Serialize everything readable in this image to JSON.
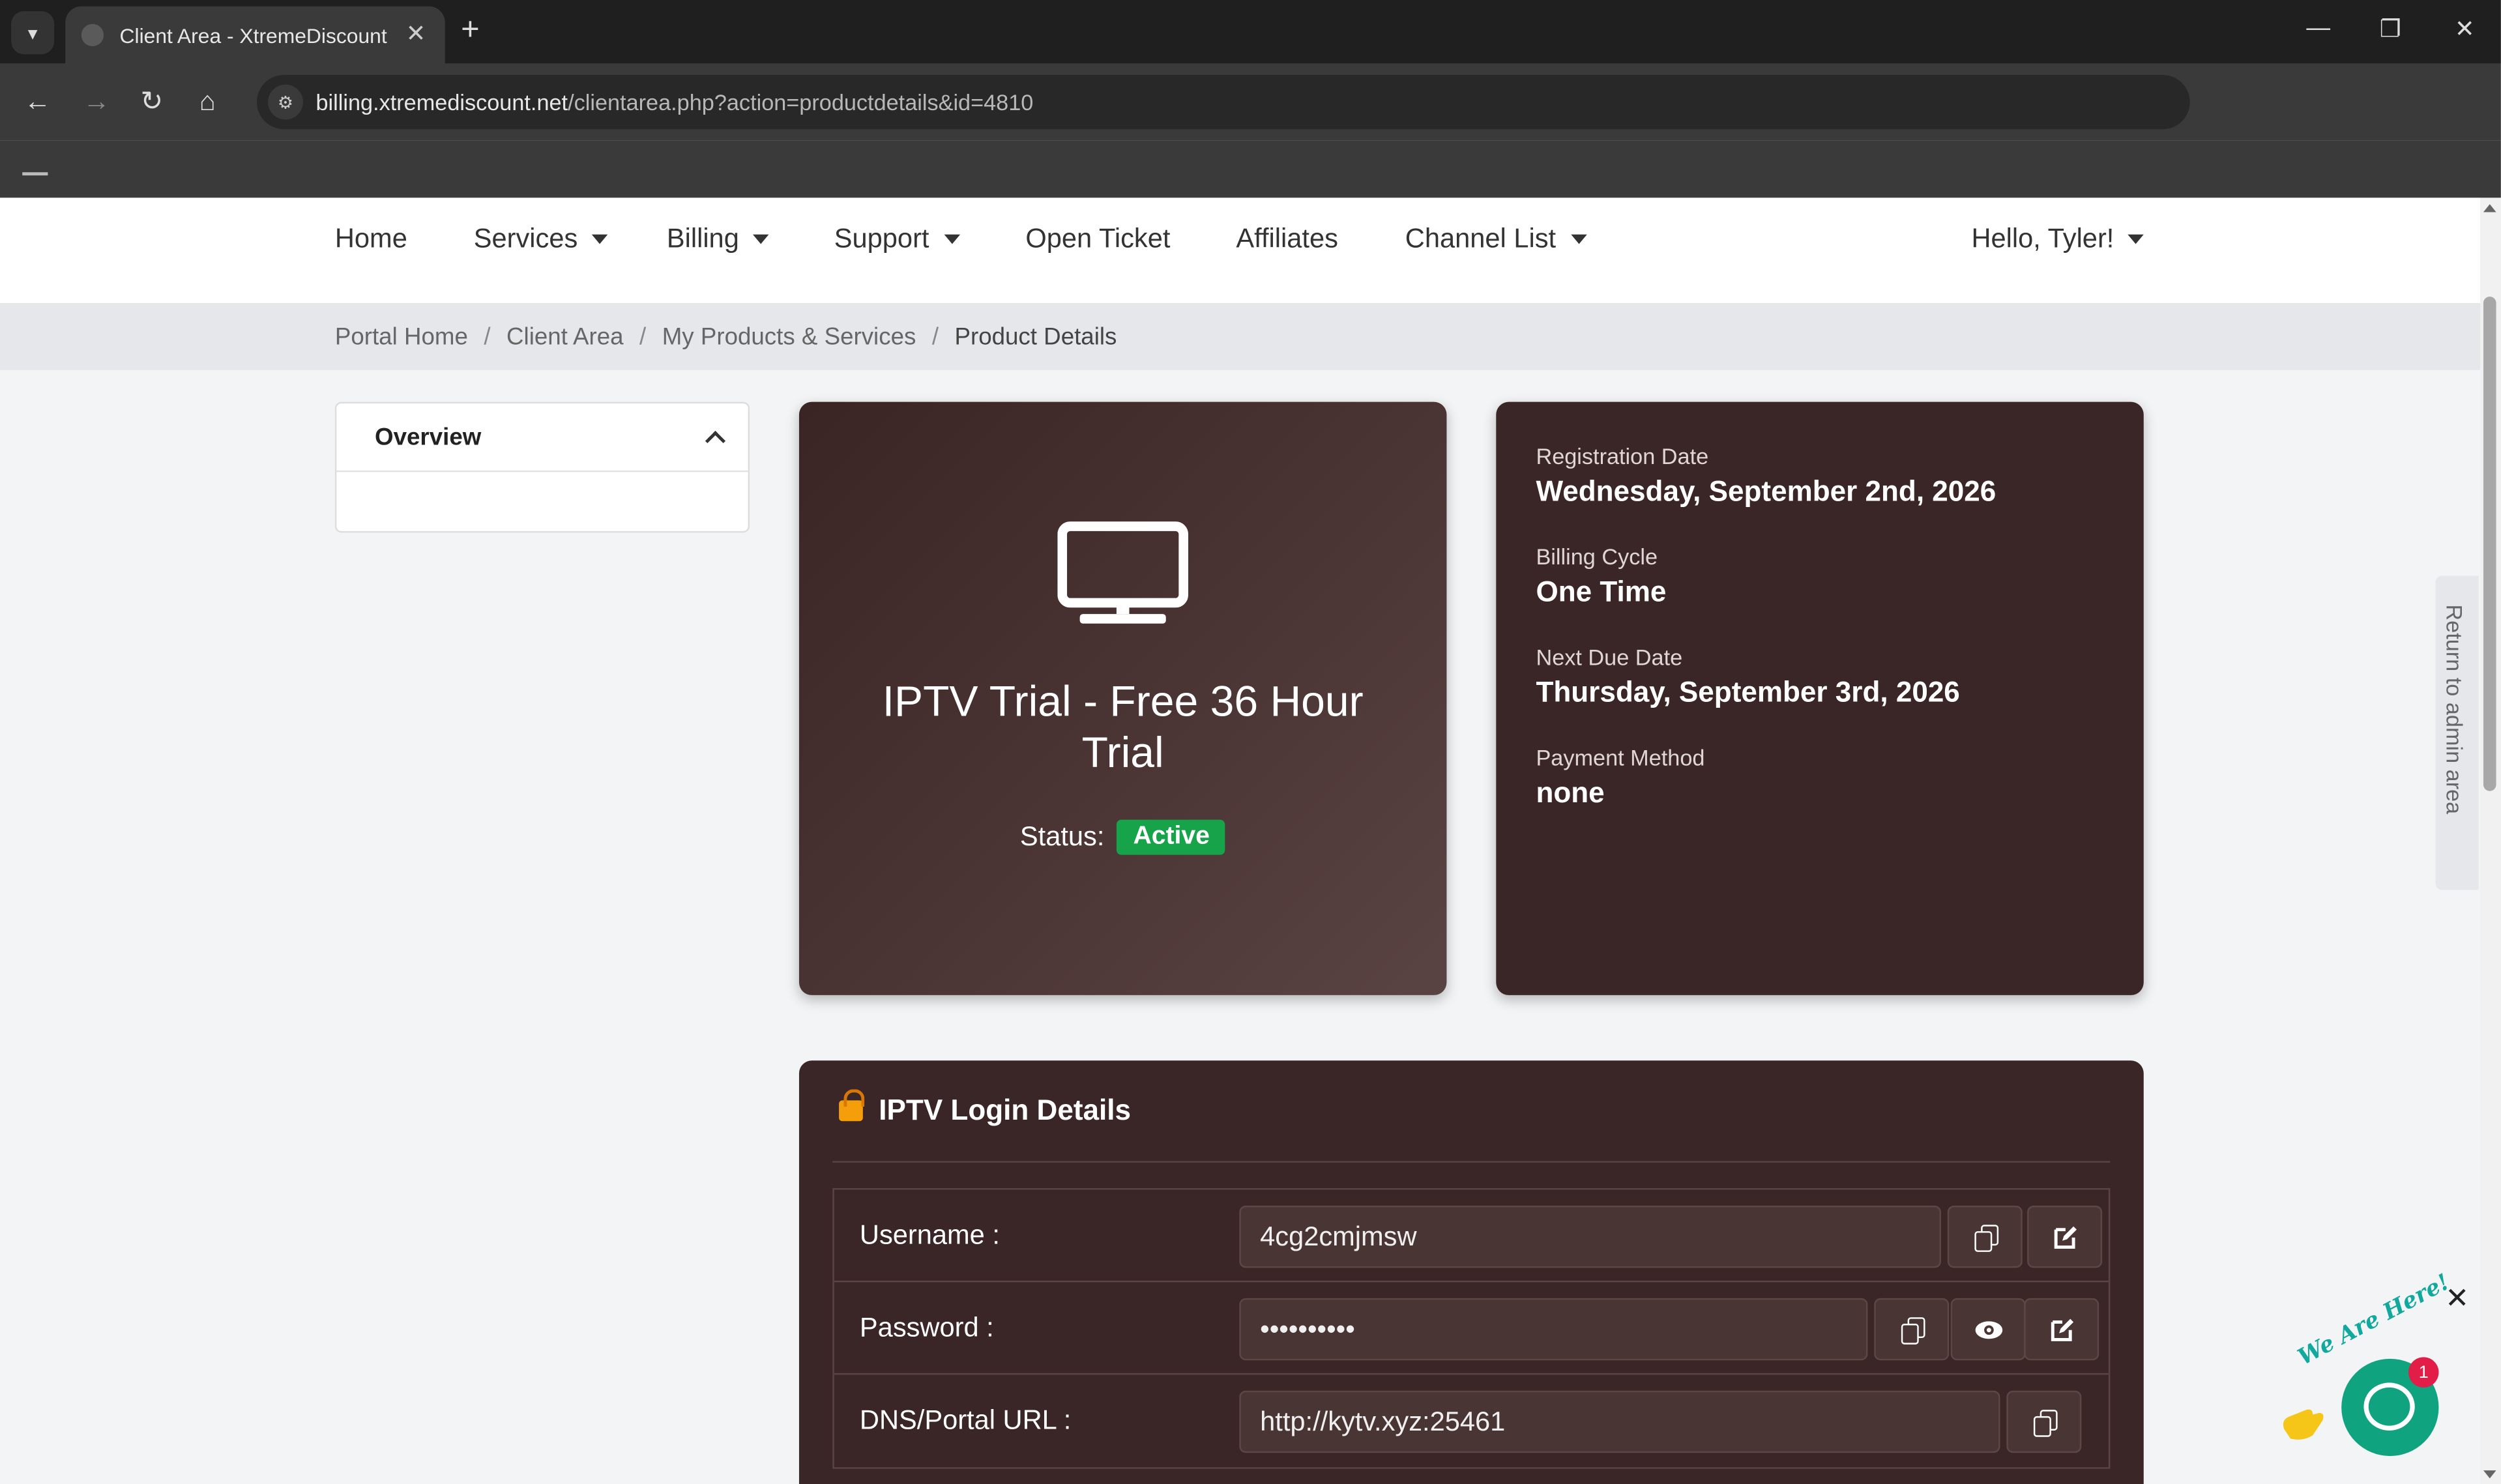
{
  "browser": {
    "tab_title": "Client Area - XtremeDiscount",
    "url_domain": "billing.xtremediscount.net",
    "url_path": "/clientarea.php?action=productdetails&id=4810"
  },
  "nav": {
    "home": "Home",
    "services": "Services",
    "billing": "Billing",
    "support": "Support",
    "open_ticket": "Open Ticket",
    "affiliates": "Affiliates",
    "channel_list": "Channel List",
    "user": "Hello, Tyler!"
  },
  "breadcrumb": {
    "portal_home": "Portal Home",
    "client_area": "Client Area",
    "products": "My Products & Services",
    "current": "Product Details",
    "separator": "/"
  },
  "sidebar": {
    "overview": "Overview"
  },
  "product": {
    "icon": "monitor-icon",
    "name": "IPTV Trial - Free 36 Hour Trial",
    "status_label": "Status:",
    "status_value": "Active",
    "status_color": "#16a34a"
  },
  "info": {
    "registration_label": "Registration Date",
    "registration_value": "Wednesday, September 2nd, 2026",
    "billing_cycle_label": "Billing Cycle",
    "billing_cycle_value": "One Time",
    "next_due_label": "Next Due Date",
    "next_due_value": "Thursday, September 3rd, 2026",
    "payment_method_label": "Payment Method",
    "payment_method_value": "none"
  },
  "login": {
    "title": "IPTV Login Details",
    "username_label": "Username :",
    "username_value": "4cg2cmjmsw",
    "password_label": "Password :",
    "password_value": "••••••••••",
    "dns_label": "DNS/Portal URL :",
    "dns_value": "http://kytv.xyz:25461"
  },
  "admin_tab": "Return to admin area",
  "chat": {
    "greeting": "We Are Here!",
    "badge_count": "1"
  },
  "colors": {
    "card_bg": "#3a2626",
    "accent_green": "#16a34a",
    "chat_green": "#10a37f"
  }
}
